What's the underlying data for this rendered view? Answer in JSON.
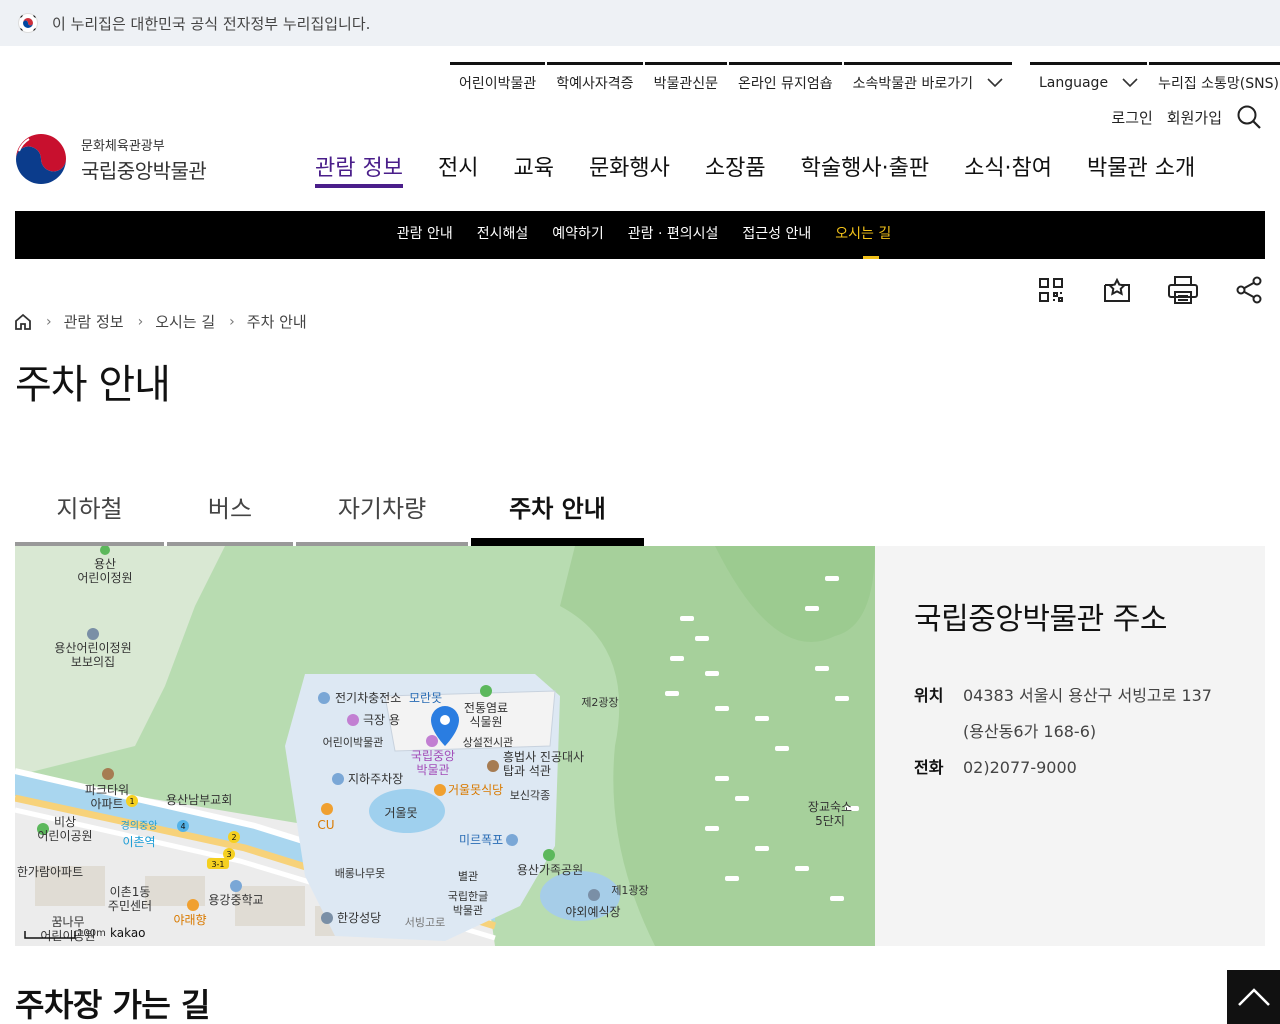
{
  "gov_banner": {
    "text": "이 누리집은 대한민국 공식 전자정부 누리집입니다."
  },
  "utility_nav": {
    "items": [
      "어린이박물관",
      "학예사자격증",
      "박물관신문",
      "온라인 뮤지엄숍",
      "소속박물관 바로가기"
    ],
    "language": "Language",
    "sns": "누리집 소통망(SNS)"
  },
  "auth": {
    "login": "로그인",
    "signup": "회원가입"
  },
  "logo": {
    "ministry": "문화체육관광부",
    "name": "국립중앙박물관"
  },
  "gnb": {
    "items": [
      "관람 정보",
      "전시",
      "교육",
      "문화행사",
      "소장품",
      "학술행사·출판",
      "소식·참여",
      "박물관 소개"
    ],
    "active_index": 0
  },
  "lnb": {
    "items": [
      "관람 안내",
      "전시해설",
      "예약하기",
      "관람 · 편의시설",
      "접근성 안내",
      "오시는 길"
    ],
    "active_index": 5
  },
  "breadcrumb": {
    "items": [
      "관람 정보",
      "오시는 길",
      "주차 안내"
    ]
  },
  "page_title": "주차 안내",
  "tabs": {
    "items": [
      "지하철",
      "버스",
      "자기차량",
      "주차 안내"
    ],
    "active_index": 3
  },
  "map": {
    "labels": {
      "yongsan_kindergarten": "용산\n어린이정원",
      "kindergarten_house": "용산어린이정원\n보보의집",
      "charging": "전기차충전소",
      "moran": "모란못",
      "theater": "극장 용",
      "children_museum": "어린이박물관",
      "nmk": "국립중앙\n박물관",
      "traditional_dye": "전통염료\n식물원",
      "permanent": "상설전시관",
      "stupa": "흥법사 진공대사\n탑과 석관",
      "underground_parking": "지하주차장",
      "geoulmot_restaurant": "거울못식당",
      "bosingak": "보신각종",
      "plaza2": "제2광장",
      "geoulmot": "거울못",
      "mireupo": "미르폭포",
      "family_park": "용산가족공원",
      "baeronamu": "배롱나무못",
      "annex": "별관",
      "hangeul_museum": "국립한글\n박물관",
      "plaza1": "제1광장",
      "outdoor": "야외예식장",
      "hangang_church": "한강성당",
      "yongsan_middle": "용강중학교",
      "park_tower": "파크타워\n아파트",
      "yongsan_south_church": "용산남부교회",
      "bisang_park": "비상\n어린이공원",
      "ichon_station": "이촌역",
      "gyeongui": "경의중앙",
      "hangaram": "한가람아파트",
      "ichon1": "이촌1동\n주민센터",
      "yarae": "야래향",
      "kkumnamu": "꿈나무\n어린이공원",
      "cu": "CU",
      "officer_housing": "장교숙소\n5단지",
      "seobinggo_road": "서빙고로"
    },
    "scale": "100m",
    "attribution": "kakao"
  },
  "address_panel": {
    "title": "국립중앙박물관 주소",
    "location_label": "위치",
    "location_line1": "04383 서울시 용산구 서빙고로 137",
    "location_line2": "(용산동6가 168-6)",
    "phone_label": "전화",
    "phone": "02)2077-9000"
  },
  "section_title": "주차장 가는 길",
  "colors": {
    "accent": "#4a1e8a",
    "lnb_active": "#f2c21a",
    "map_green": "#b8dcb1"
  }
}
